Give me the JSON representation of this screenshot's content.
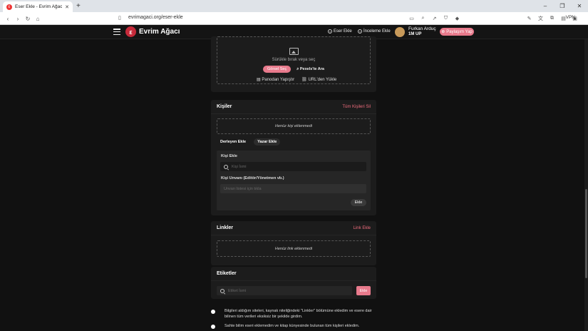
{
  "browser": {
    "tab_title": "Eser Ekle - Evrim Ağacı",
    "url": "evrimagaci.org/eser-ekle",
    "vpn": "VPN"
  },
  "header": {
    "brand": "Evrim Ağacı",
    "add_work": "Eser Ekle",
    "add_review": "İnceleme Ekle",
    "user_name": "Furkan Arduç",
    "user_score": "1M UP",
    "share": "Paylaşım Yap"
  },
  "upload": {
    "drop_text": "Sürükle bırak veya seç",
    "pick_image": "Görsel Seç",
    "search_pexels": "Pexels'te Ara",
    "paste_clipboard": "Panodan Yapıştır",
    "load_url": "URL'den Yükle"
  },
  "people": {
    "title": "Kişiler",
    "clear_all": "Tüm Kişileri Sil",
    "empty": "Henüz kişi eklenmedi",
    "add_editor": "Derleyen Ekle",
    "add_author": "Yazar Ekle",
    "person_label": "Kişi Ekle",
    "person_placeholder": "Kişi İsmi",
    "role_label": "Kişi Unvanı (Editör/Yönetmen vb.)",
    "role_placeholder": "Unvan listesi için tıkla",
    "add": "Ekle"
  },
  "links": {
    "title": "Linkler",
    "add_link": "Link Ekle",
    "empty": "Henüz link eklenmedi"
  },
  "tags": {
    "title": "Etiketler",
    "placeholder": "Etiket İsmi",
    "add": "Ekle"
  },
  "confirmations": [
    "Bilgileri aldığım siteleri, kaynak niteliğindeki \"Linkler\" bölümüne ekledim ve esere dair bilinen tüm verileri eksiksiz bir şekilde girdim.",
    "Sahte bilim eseri eklemedim ve kitap künyesinde bulunan tüm kişileri ekledim."
  ],
  "colors": {
    "accent": "#e87a8c",
    "link_red": "#ef6c7d",
    "brand_red": "#c62a3a"
  }
}
